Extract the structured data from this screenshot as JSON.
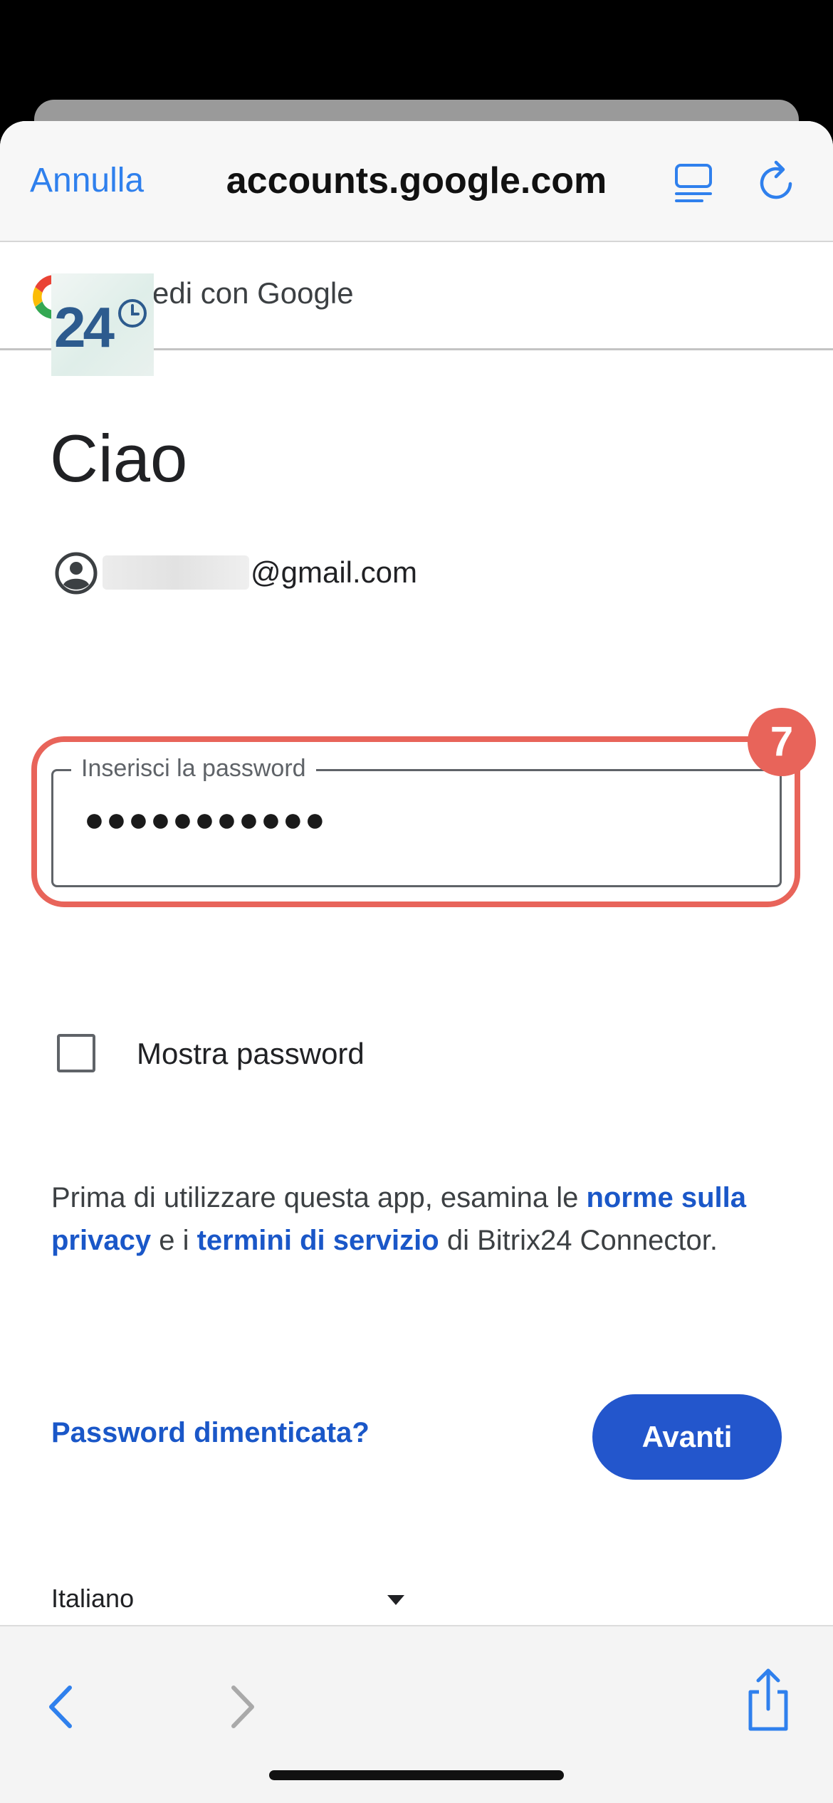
{
  "nav": {
    "cancel_label": "Annulla",
    "host": "accounts.google.com",
    "reader_icon": "reader-mode-icon",
    "reload_icon": "reload-icon"
  },
  "google_bar": {
    "logo": "google-g-logo",
    "title": "Accedi con Google"
  },
  "app": {
    "logo_text": "24"
  },
  "greeting": "Ciao",
  "account": {
    "email_suffix": "@gmail.com"
  },
  "password": {
    "label": "Inserisci la password",
    "masked_value": "●●●●●●●●●●●"
  },
  "annotation": {
    "badge": "7",
    "color": "#e8645a"
  },
  "show_password": {
    "label": "Mostra password",
    "checked": false
  },
  "consent": {
    "pre": "Prima di utilizzare questa app, esamina le ",
    "privacy_link": "norme sulla privacy",
    "mid": " e i ",
    "terms_link": "termini di servizio",
    "post": " di Bitrix24 Connector."
  },
  "actions": {
    "forgot_label": "Password dimenticata?",
    "next_label": "Avanti"
  },
  "language": {
    "selected": "Italiano"
  },
  "colors": {
    "accent": "#2356cc",
    "link": "#1a57c8",
    "ios_blue": "#2f80ed"
  }
}
